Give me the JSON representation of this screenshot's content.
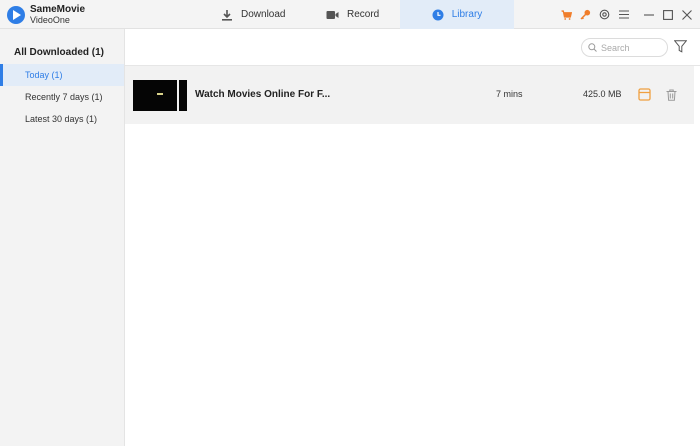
{
  "app": {
    "name": "SameMovie",
    "subtitle": "VideoOne"
  },
  "tabs": [
    {
      "label": "Download",
      "icon": "download-icon"
    },
    {
      "label": "Record",
      "icon": "camera-icon"
    },
    {
      "label": "Library",
      "icon": "clock-icon",
      "active": true
    }
  ],
  "titlebar_icons": [
    "cart-icon",
    "key-icon",
    "settings-icon",
    "menu-icon",
    "minimize-icon",
    "maximize-icon",
    "close-icon"
  ],
  "sidebar": {
    "title": "All Downloaded (1)",
    "items": [
      {
        "label": "Today (1)",
        "active": true
      },
      {
        "label": "Recently 7 days (1)"
      },
      {
        "label": "Latest 30 days (1)"
      }
    ]
  },
  "search": {
    "placeholder": "Search"
  },
  "library": {
    "rows": [
      {
        "title": "Watch Movies Online For F...",
        "duration": "7 mins",
        "size": "425.0 MB"
      }
    ]
  },
  "colors": {
    "accent": "#2f7ee6",
    "active_bg": "#e2ecf8",
    "open_icon": "#f0a040",
    "cart": "#f07d2a"
  }
}
